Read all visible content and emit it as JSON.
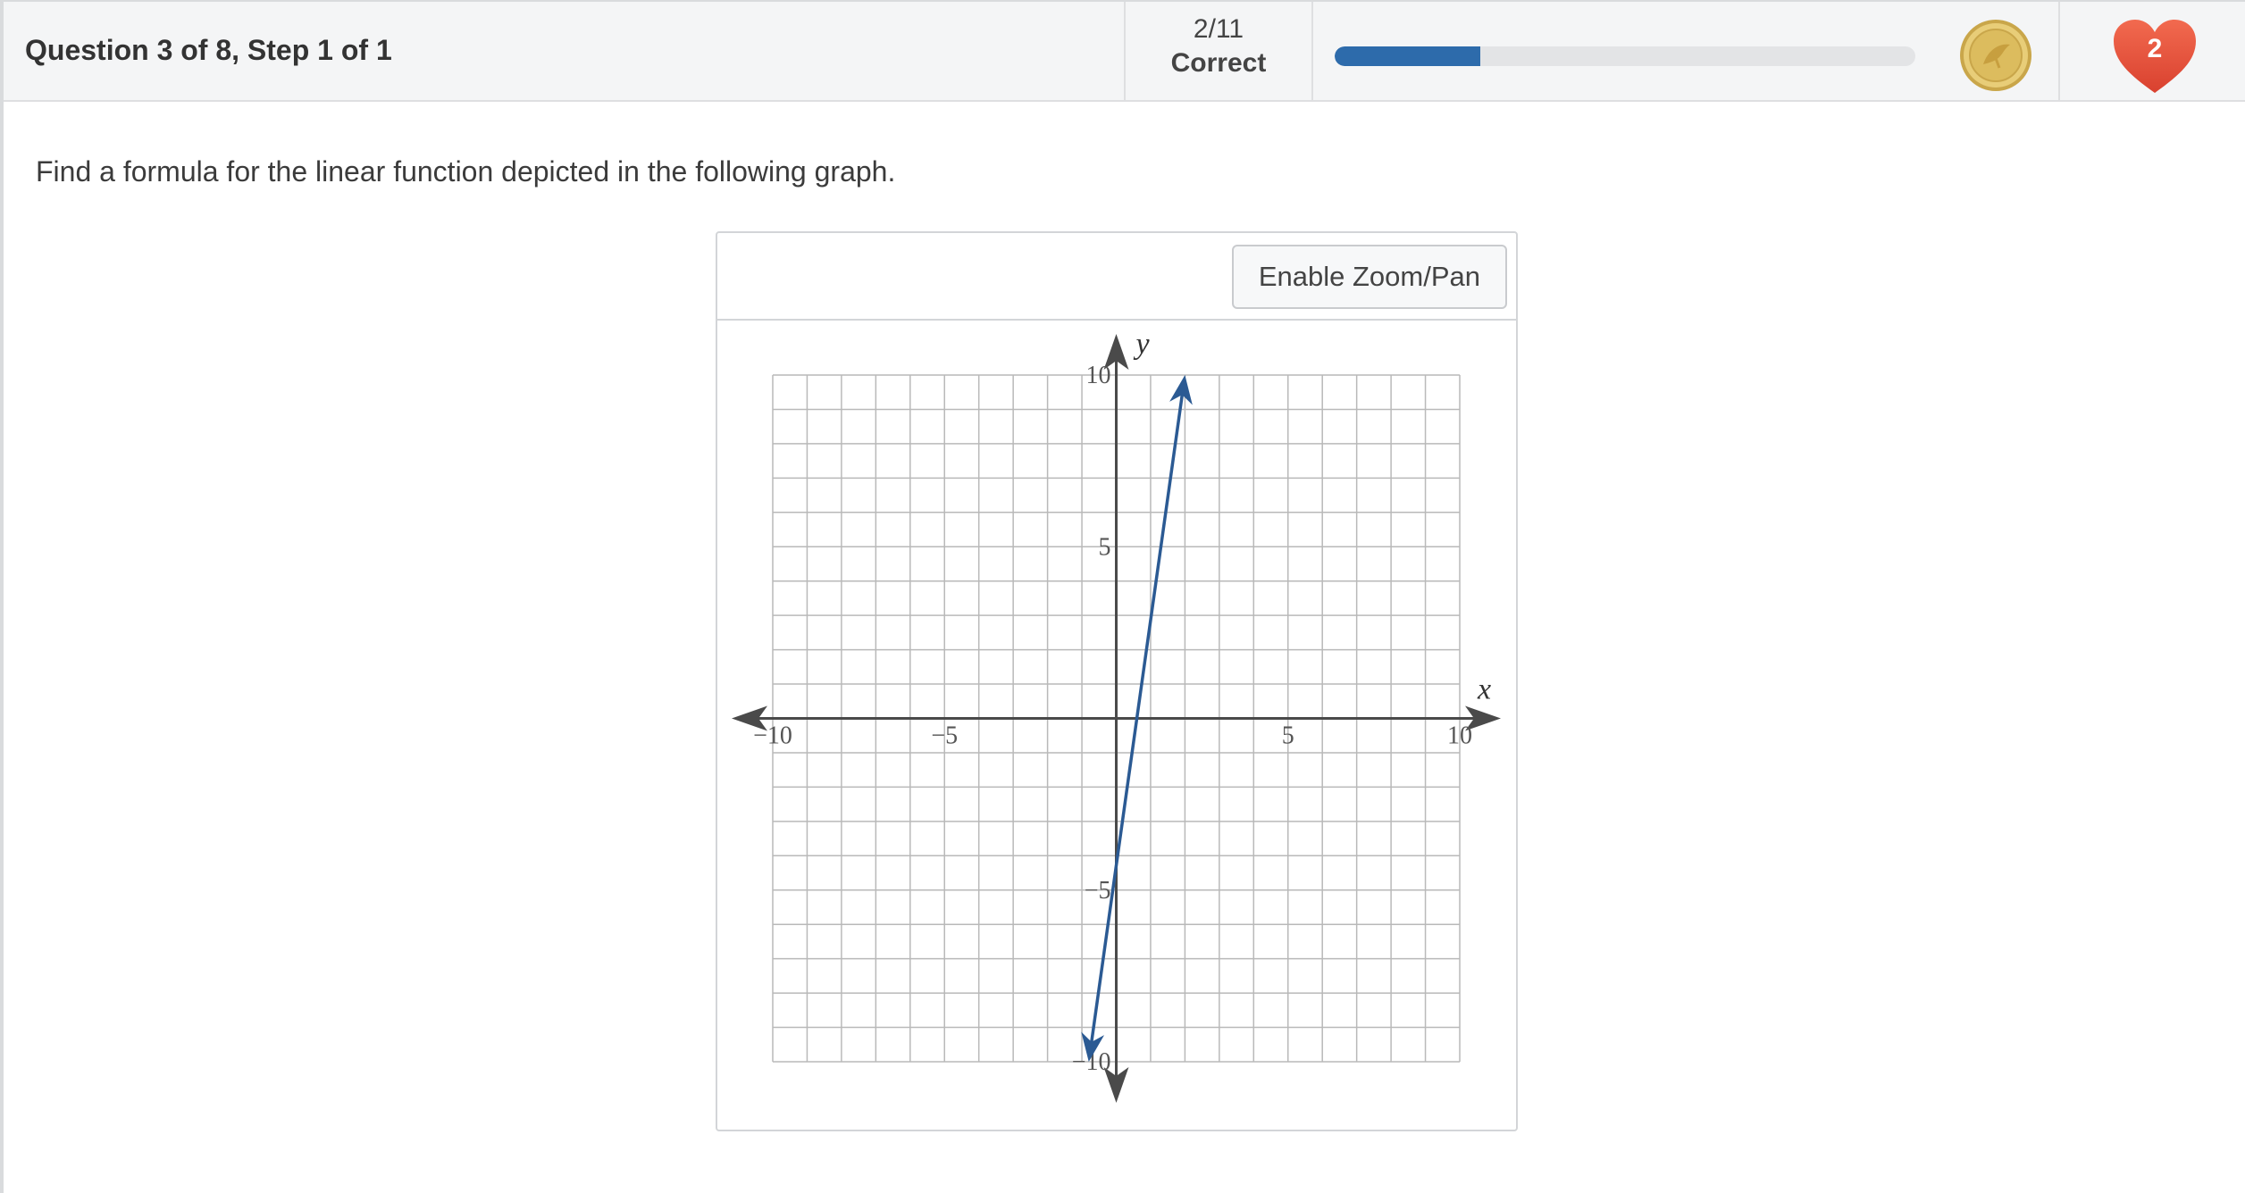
{
  "header": {
    "question_title": "Question 3 of 8, Step 1 of 1",
    "score_fraction": "2/11",
    "score_status": "Correct",
    "progress": 0.25,
    "hearts_count": "2",
    "coin_icon": "coin-icon",
    "heart_icon": "heart-icon",
    "accent_color": "#2d6bab",
    "heart_color": "#e04b3c"
  },
  "question": {
    "prompt": "Find a formula for the linear function depicted in the following graph."
  },
  "graph": {
    "zoom_button_label": "Enable Zoom/Pan",
    "x_axis_label": "x",
    "y_axis_label": "y",
    "x_tick_labels": [
      "−10",
      "−5",
      "5",
      "10"
    ],
    "y_tick_labels": [
      "10",
      "5",
      "−5",
      "−10"
    ],
    "line_color": "#2b5a93"
  },
  "chart_data": {
    "type": "line",
    "title": "",
    "xlabel": "x",
    "ylabel": "y",
    "xlim": [
      -10,
      10
    ],
    "ylim": [
      -10,
      10
    ],
    "grid": true,
    "series": [
      {
        "x": [
          -0.8,
          2
        ],
        "y": [
          -10,
          10
        ]
      }
    ]
  }
}
